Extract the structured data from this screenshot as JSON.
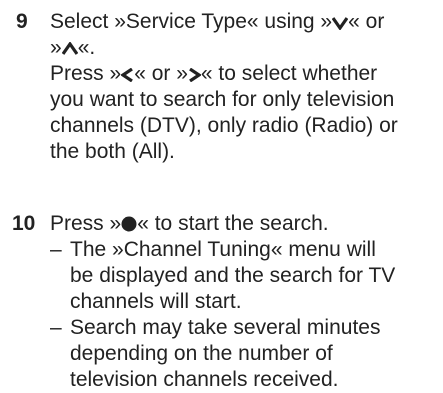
{
  "step9": {
    "number": "9",
    "line1_a": "Select »Service Type« using »",
    "down_symbol": "V",
    "line1_b": "« or",
    "line2_a": "»",
    "up_symbol": "Λ",
    "line2_b": "«.",
    "line3_a": "Press »",
    "left_symbol": "<",
    "line3_b": "« or »",
    "right_symbol": ">",
    "line3_c": "« to select whether",
    "line4": "you want to search for only television",
    "line5": "channels (DTV), only radio (Radio) or",
    "line6": "the both (All)."
  },
  "step10": {
    "number": "10",
    "line1_a": "Press »",
    "ok_symbol": "●",
    "line1_b": "« to start the search.",
    "bullets": [
      {
        "dash": "–",
        "lines": [
          "The »Channel Tuning« menu will",
          "be displayed and the search for TV",
          "channels will start."
        ]
      },
      {
        "dash": "–",
        "lines": [
          "Search may take several minutes",
          "depending on the number of",
          "television channels received."
        ]
      }
    ]
  },
  "icons": {
    "down": "chevron-down-icon",
    "up": "chevron-up-icon",
    "left": "chevron-left-icon",
    "right": "chevron-right-icon",
    "ok": "ok-button-icon"
  }
}
